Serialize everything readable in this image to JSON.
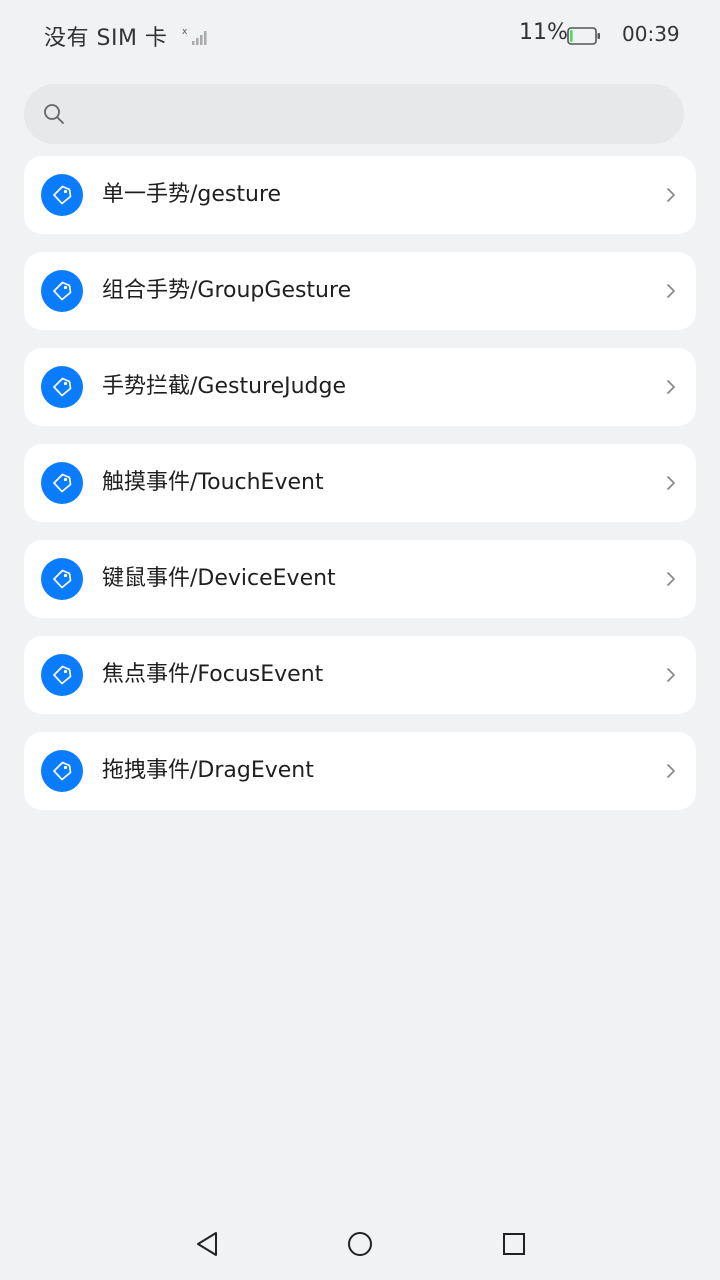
{
  "status_bar": {
    "carrier": "没有 SIM 卡",
    "battery_percent": "11%",
    "time": "00:39",
    "battery_level": 0.11,
    "battery_color": "#4cd964"
  },
  "search": {
    "placeholder": "",
    "value": ""
  },
  "accent_color": "#0a7cff",
  "items": [
    {
      "label": "单一手势/gesture",
      "icon": "tag-icon"
    },
    {
      "label": "组合手势/GroupGesture",
      "icon": "tag-icon"
    },
    {
      "label": "手势拦截/GestureJudge",
      "icon": "tag-icon"
    },
    {
      "label": "触摸事件/TouchEvent",
      "icon": "tag-icon"
    },
    {
      "label": "键鼠事件/DeviceEvent",
      "icon": "tag-icon"
    },
    {
      "label": "焦点事件/FocusEvent",
      "icon": "tag-icon"
    },
    {
      "label": "拖拽事件/DragEvent",
      "icon": "tag-icon"
    }
  ],
  "nav_bar": {
    "back": "back-icon",
    "home": "home-icon",
    "recent": "recent-apps-icon"
  }
}
